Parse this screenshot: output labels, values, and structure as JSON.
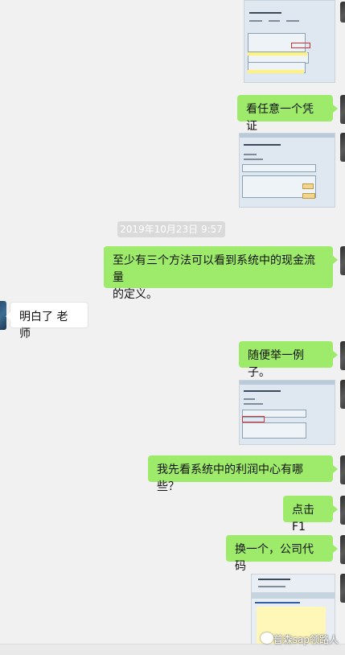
{
  "timestamp": "2019年10月23日 9:57",
  "messages": {
    "m1": "看任意一个凭证",
    "m2_line1": "至少有三个方法可以看到系统中的现金流量",
    "m2_line2": "的定义。",
    "m3": "明白了  老师",
    "m4": "随便举一例子。",
    "m5": "我先看系统中的利润中心有哪些？",
    "m6": "点击F1",
    "m7": "换一个，公司代码"
  },
  "watermark": "普森sap领路人"
}
